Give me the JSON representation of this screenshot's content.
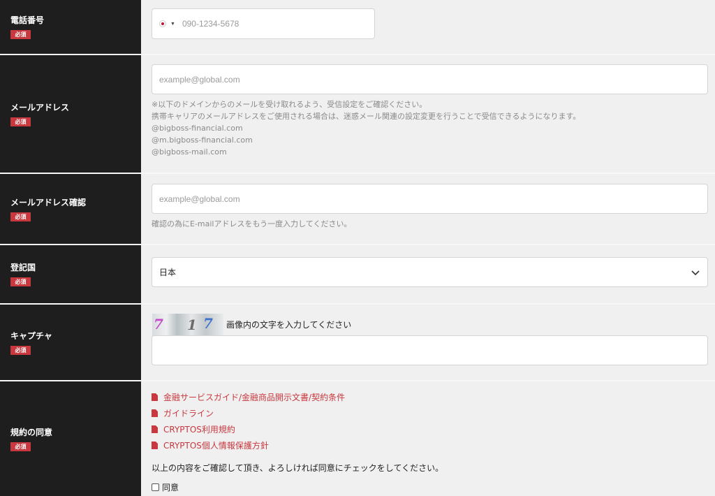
{
  "rows": {
    "phone": {
      "label": "電話番号",
      "badge": "必須",
      "placeholder": "090-1234-5678"
    },
    "email": {
      "label": "メールアドレス",
      "badge": "必須",
      "placeholder": "example@global.com",
      "notes": [
        "※以下のドメインからのメールを受け取れるよう、受信設定をご確認ください。",
        "携帯キャリアのメールアドレスをご使用される場合は、迷惑メール関連の設定変更を行うことで受信できるようになります。",
        "@bigboss-financial.com",
        "@m.bigboss-financial.com",
        "@bigboss-mail.com"
      ]
    },
    "email_confirm": {
      "label": "メールアドレス確認",
      "badge": "必須",
      "placeholder": "example@global.com",
      "note": "確認の為にE-mailアドレスをもう一度入力してください。"
    },
    "country": {
      "label": "登記国",
      "badge": "必須",
      "selected": "日本"
    },
    "captcha": {
      "label": "キャプチャ",
      "badge": "必須",
      "image_text": "7 1 7",
      "instruction": "画像内の文字を入力してください"
    },
    "terms": {
      "label": "規約の同意",
      "badge": "必須",
      "links": [
        "金融サービスガイド/金融商品開示文書/契約条件",
        "ガイドライン",
        "CRYPTOS利用規約",
        "CRYPTOS個人情報保護方針"
      ],
      "confirm_text": "以上の内容をご確認して頂き、よろしければ同意にチェックをしてください。",
      "checkbox_label": "同意"
    }
  },
  "icons": {
    "flag": "japan-flag-icon",
    "select": "chevron-down-icon",
    "document": "document-icon"
  },
  "colors": {
    "label_bg": "#1e1e1e",
    "badge": "#c8383e",
    "link": "#c8383e",
    "content_bg": "#f0f0f0"
  }
}
